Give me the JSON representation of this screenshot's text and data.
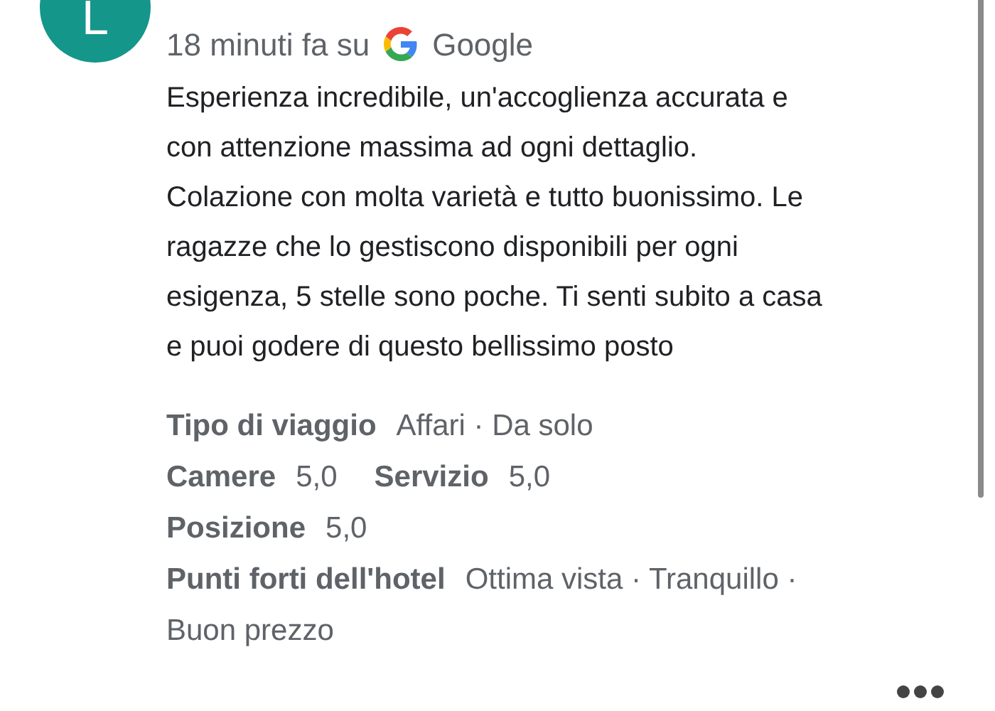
{
  "review": {
    "avatar_letter": "L",
    "time": "18 minuti fa su",
    "source": "Google",
    "text": "Esperienza incredibile, un'accoglienza accurata e con attenzione massima ad ogni dettaglio. Colazione con molta varietà e tutto buonissimo. Le ragazze che lo gestiscono disponibili per ogni esigenza, 5 stelle sono poche. Ti senti subito a casa e puoi godere di questo bellissimo posto",
    "details": [
      [
        {
          "label": "Tipo di viaggio",
          "value": "Affari · Da solo"
        }
      ],
      [
        {
          "label": "Camere",
          "value": "5,0"
        },
        {
          "label": "Servizio",
          "value": "5,0"
        }
      ],
      [
        {
          "label": "Posizione",
          "value": "5,0"
        }
      ],
      [
        {
          "label": "Punti forti dell'hotel",
          "value": "Ottima vista · Tranquillo · Buon prezzo"
        }
      ]
    ]
  }
}
